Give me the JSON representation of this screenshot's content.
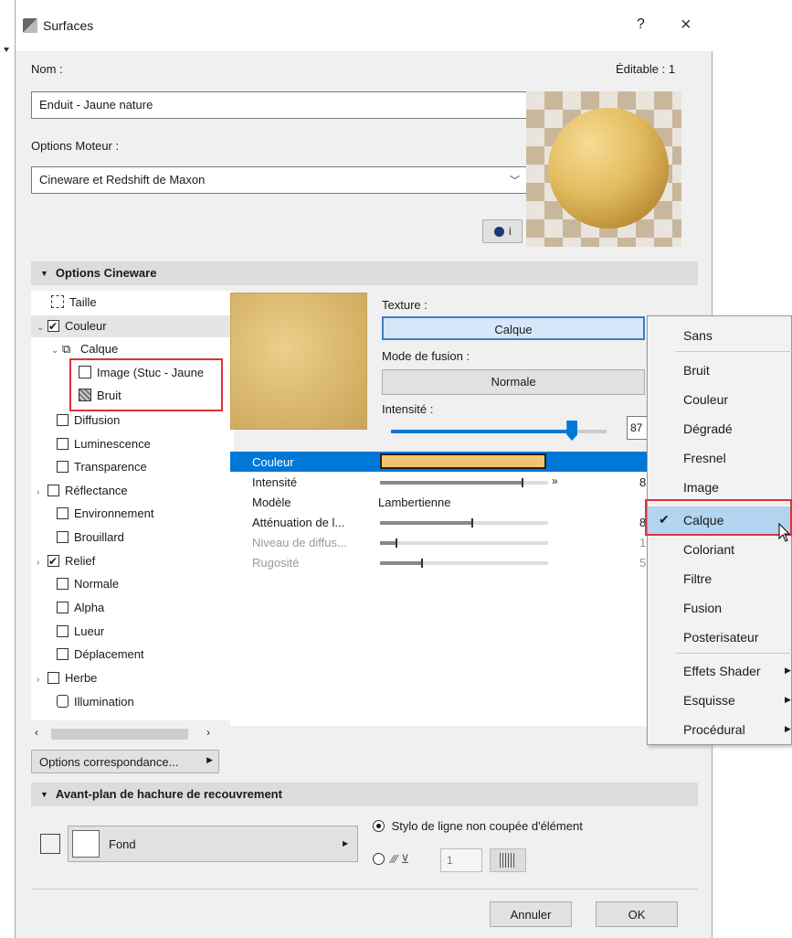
{
  "window": {
    "title": "Surfaces",
    "help": "?",
    "close": "×"
  },
  "header": {
    "name_label": "Nom :",
    "editable_label": "Éditable : 1",
    "name_value": "Enduit - Jaune nature",
    "engine_label": "Options Moteur :",
    "engine_value": "Cineware et Redshift de Maxon",
    "info_button": "i"
  },
  "cineware": {
    "section_title": "Options Cineware",
    "tree": [
      {
        "label": "Taille",
        "checked": null
      },
      {
        "label": "Couleur",
        "checked": true
      },
      {
        "label": "Calque"
      },
      {
        "label": "Image (Stuc - Jaune"
      },
      {
        "label": "Bruit"
      },
      {
        "label": "Diffusion",
        "checked": false
      },
      {
        "label": "Luminescence",
        "checked": false
      },
      {
        "label": "Transparence",
        "checked": false
      },
      {
        "label": "Réflectance",
        "checked": false
      },
      {
        "label": "Environnement",
        "checked": false
      },
      {
        "label": "Brouillard",
        "checked": false
      },
      {
        "label": "Relief",
        "checked": true
      },
      {
        "label": "Normale",
        "checked": false
      },
      {
        "label": "Alpha",
        "checked": false
      },
      {
        "label": "Lueur",
        "checked": false
      },
      {
        "label": "Déplacement",
        "checked": false
      },
      {
        "label": "Herbe",
        "checked": false
      },
      {
        "label": "Illumination",
        "checked": null
      }
    ],
    "options_button": "Options correspondance...",
    "texture_label": "Texture :",
    "texture_value": "Calque",
    "blend_label": "Mode de fusion :",
    "blend_value": "Normale",
    "intensity_label": "Intensité :",
    "intensity_value": "87",
    "intensity_level": 0.84,
    "properties": [
      {
        "name": "Couleur",
        "value": "",
        "num": ""
      },
      {
        "name": "Intensité",
        "value": "",
        "num": "8",
        "level": 0.85
      },
      {
        "name": "Modèle",
        "value": "Lambertienne",
        "num": ""
      },
      {
        "name": "Atténuation de l...",
        "value": "",
        "num": "8",
        "level": 0.55
      },
      {
        "name": "Niveau de diffus...",
        "value": "",
        "num": "10",
        "level": 0.1
      },
      {
        "name": "Rugosité",
        "value": "",
        "num": "5",
        "level": 0.25
      }
    ],
    "swatch_color": "#f1c56f"
  },
  "menu": {
    "items": [
      {
        "label": "Sans"
      },
      {
        "label": "Bruit"
      },
      {
        "label": "Couleur"
      },
      {
        "label": "Dégradé"
      },
      {
        "label": "Fresnel"
      },
      {
        "label": "Image"
      },
      {
        "label": "Calque",
        "checked": true,
        "highlighted": true
      },
      {
        "label": "Coloriant"
      },
      {
        "label": "Filtre"
      },
      {
        "label": "Fusion"
      },
      {
        "label": "Posterisateur"
      },
      {
        "label": "Effets Shader",
        "submenu": true
      },
      {
        "label": "Esquisse",
        "submenu": true
      },
      {
        "label": "Procédural",
        "submenu": true
      }
    ],
    "check_mark": "✔"
  },
  "hatch": {
    "section_title": "Avant-plan de hachure de recouvrement",
    "fond_label": "Fond",
    "radio1_label": "Stylo de ligne non coupée d'élément",
    "pen_value": "1"
  },
  "footer": {
    "cancel": "Annuler",
    "ok": "OK"
  },
  "colors": {
    "accent": "#0078d7",
    "highlight_border": "#e0313a",
    "menu_highlight": "#b3d4f0"
  }
}
